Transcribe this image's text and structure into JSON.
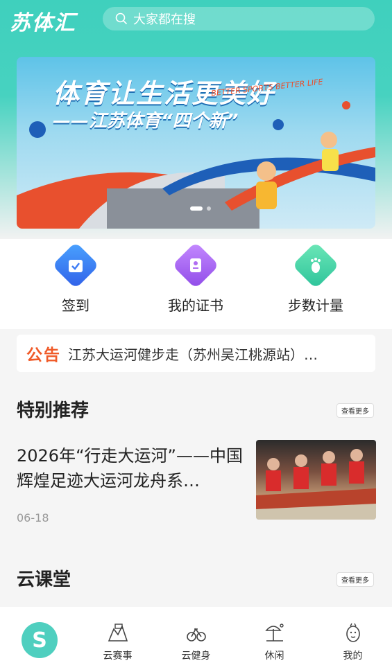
{
  "app": {
    "logo": "苏体汇"
  },
  "search": {
    "placeholder": "大家都在搜"
  },
  "banner": {
    "title": "体育让生活更美好",
    "subtitle": "——江苏体育“四个新”",
    "english": "BETTER SPORTS BETTER LIFE"
  },
  "quick_actions": [
    {
      "label": "签到",
      "icon": "calendar-check-icon",
      "color": "#3d7cf5"
    },
    {
      "label": "我的证书",
      "icon": "certificate-icon",
      "color": "#b06df2"
    },
    {
      "label": "步数计量",
      "icon": "footprint-icon",
      "color": "#3fd4a0"
    }
  ],
  "notice": {
    "tag": "公告",
    "text": "江苏大运河健步走（苏州吴江桃源站）…"
  },
  "special": {
    "title": "特别推荐",
    "more": "查看更多",
    "item": {
      "title": "2026年“行走大运河”——中国辉煌足迹大运河龙舟系…",
      "date": "06-18"
    }
  },
  "cloud_class": {
    "title": "云课堂",
    "more": "查看更多"
  },
  "tabbar": [
    {
      "label": "",
      "icon": "home-logo-icon"
    },
    {
      "label": "云赛事",
      "icon": "event-icon"
    },
    {
      "label": "云健身",
      "icon": "bike-icon"
    },
    {
      "label": "休闲",
      "icon": "leisure-icon"
    },
    {
      "label": "我的",
      "icon": "profile-icon"
    }
  ],
  "colors": {
    "accent": "#3fd0bd",
    "notice": "#f05a28"
  }
}
